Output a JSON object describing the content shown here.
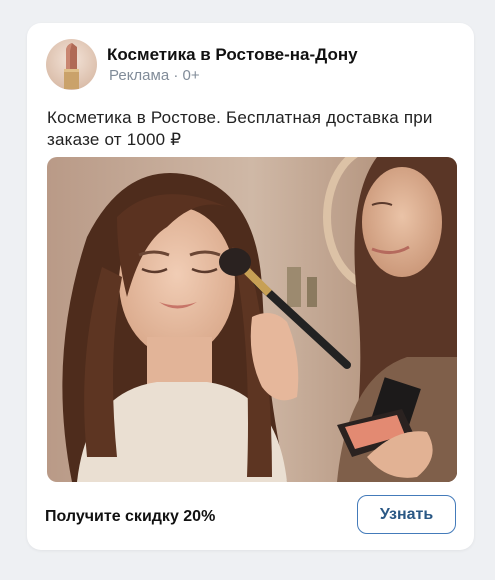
{
  "ad": {
    "title": "Косметика в Ростове-на-Дону",
    "meta": "Реклама · 0+",
    "description": "Косметика в Ростове. Бесплатная доставка при заказе от 1000 ₽",
    "image_alt": "photo",
    "footer_text": "Получите скидку 20%",
    "cta_label": "Узнать"
  },
  "colors": {
    "accent": "#2a5885",
    "meta": "#818c99"
  }
}
